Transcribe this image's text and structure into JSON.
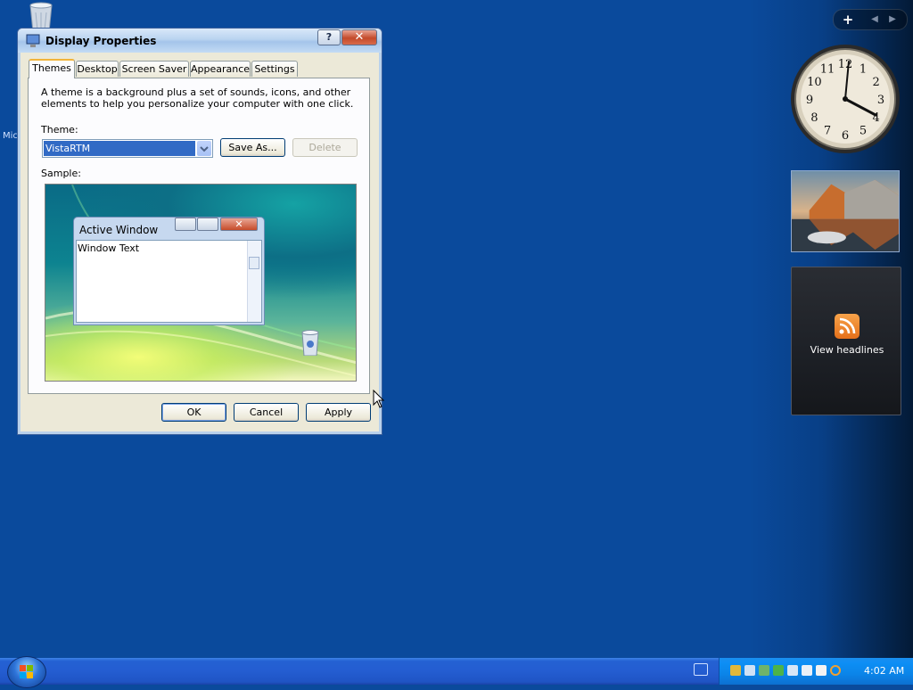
{
  "dialog": {
    "title": "Display Properties",
    "help_glyph": "?",
    "close_glyph": "✕",
    "tabs": [
      "Themes",
      "Desktop",
      "Screen Saver",
      "Appearance",
      "Settings"
    ],
    "active_tab": "Themes",
    "description": "A theme is a background plus a set of sounds, icons, and other elements to help you personalize your computer with one click.",
    "theme_label": "Theme:",
    "theme_value": "VistaRTM",
    "save_as_label": "Save As...",
    "delete_label": "Delete",
    "sample_label": "Sample:",
    "sample_window": {
      "title": "Active Window",
      "text": "Window Text",
      "close_glyph": "✕"
    },
    "ok_label": "OK",
    "cancel_label": "Cancel",
    "apply_label": "Apply"
  },
  "desktop": {
    "partial_icon_label": "Micr"
  },
  "sidebar": {
    "add_glyph": "+",
    "prev_glyph": "◀",
    "next_glyph": "▶",
    "clock_numbers": [
      "12",
      "1",
      "2",
      "3",
      "4",
      "5",
      "6",
      "7",
      "8",
      "9",
      "10",
      "11"
    ],
    "feeds_label": "View headlines"
  },
  "taskbar": {
    "time": "4:02 AM"
  },
  "colors": {
    "desktop": "#0a4a9c",
    "taskbar": "#245dd1",
    "tray": "#0b85e9",
    "selection": "#316ac5"
  }
}
